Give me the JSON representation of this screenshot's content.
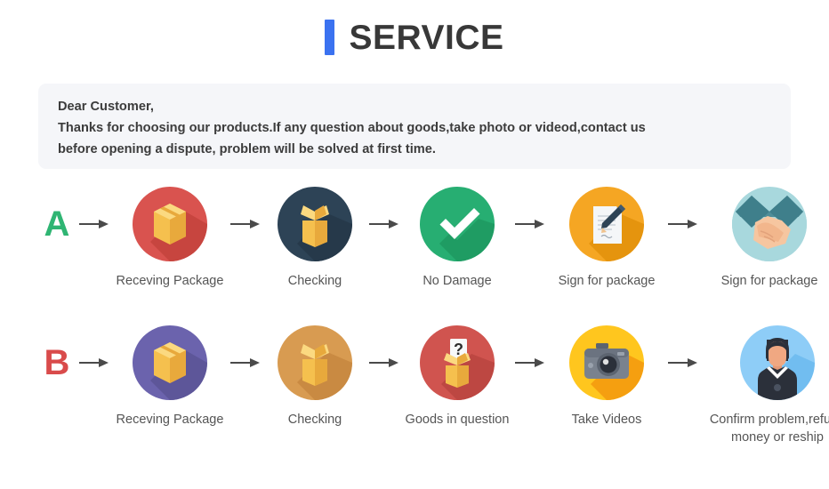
{
  "header": {
    "title": "SERVICE",
    "accent_color": "#3b72f0"
  },
  "notice": {
    "line1": "Dear Customer,",
    "line2": "Thanks for choosing our products.If any question about goods,take photo or videod,contact us",
    "line3": "before opening a dispute, problem will be solved at first time."
  },
  "flows": [
    {
      "letter": "A",
      "letter_color": "#2fb573",
      "steps": [
        {
          "label": "Receving Package",
          "icon": "package-box-icon",
          "circle_color": "#d9534f"
        },
        {
          "label": "Checking",
          "icon": "open-box-icon",
          "circle_color": "#2d4356"
        },
        {
          "label": "No Damage",
          "icon": "check-mark-icon",
          "circle_color": "#27ae72"
        },
        {
          "label": "Sign for package",
          "icon": "document-pen-icon",
          "circle_color": "#f5a623"
        },
        {
          "label": "Sign for package",
          "icon": "handshake-icon",
          "circle_color": "#a8d8dd"
        }
      ]
    },
    {
      "letter": "B",
      "letter_color": "#d94b4b",
      "steps": [
        {
          "label": "Receving Package",
          "icon": "package-box-icon",
          "circle_color": "#6b63ad"
        },
        {
          "label": "Checking",
          "icon": "open-box-icon",
          "circle_color": "#d89b51"
        },
        {
          "label": "Goods in question",
          "icon": "question-box-icon",
          "circle_color": "#d0544f"
        },
        {
          "label": "Take Videos",
          "icon": "camera-icon",
          "circle_color": "#ffc61e"
        },
        {
          "label": "Confirm problem,refund\nmoney or reship",
          "icon": "support-person-icon",
          "circle_color": "#8ecdf7"
        }
      ]
    }
  ]
}
